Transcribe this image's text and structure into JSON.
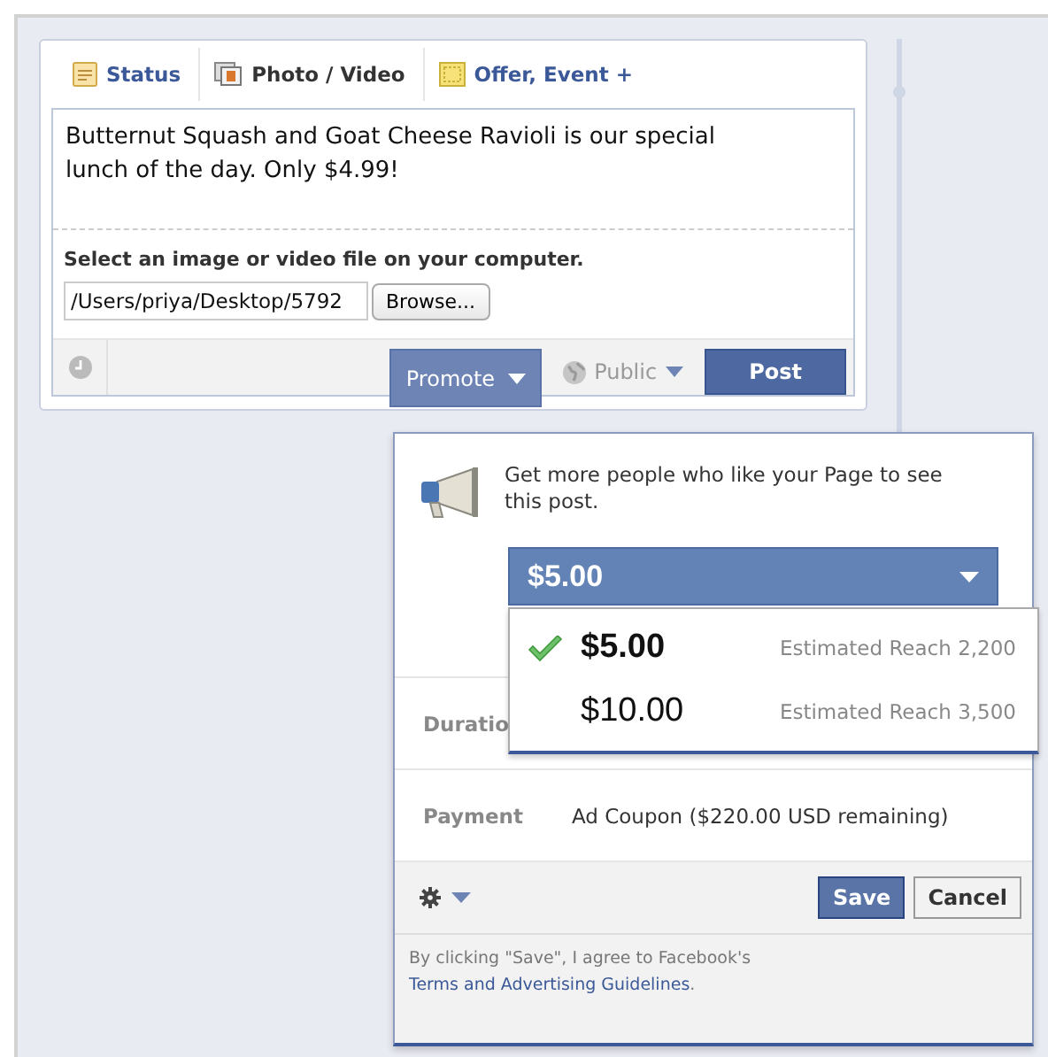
{
  "tabs": [
    {
      "label": "Status",
      "kind": "status",
      "selected": false
    },
    {
      "label": "Photo / Video",
      "kind": "photo",
      "selected": true
    },
    {
      "label": "Offer, Event +",
      "kind": "offer",
      "selected": false
    }
  ],
  "composer": {
    "text": "Butternut Squash and Goat Cheese Ravioli is our special lunch of the day. Only $4.99!",
    "upload_prompt": "Select an image or video file on your computer.",
    "file_path": "/Users/priya/Desktop/5792",
    "browse_button": "Browse..."
  },
  "actions": {
    "promote": "Promote",
    "promote_expanded": true,
    "privacy": "Public",
    "post": "Post"
  },
  "promote_popup": {
    "message": "Get more people who like your Page to see this post.",
    "budget": {
      "value": "$5.00",
      "expanded": true,
      "options": [
        {
          "amount": "$5.00",
          "reach": "Estimated Reach 2,200",
          "selected": true
        },
        {
          "amount": "$10.00",
          "reach": "Estimated Reach 3,500",
          "selected": false
        }
      ]
    },
    "details": [
      {
        "label": "Duratio"
      },
      {
        "label": "Payment",
        "value": "Ad Coupon ($220.00 USD remaining)"
      }
    ],
    "save": "Save",
    "cancel": "Cancel",
    "legal": "By clicking \"Save\", I agree to Facebook's",
    "legal_link": "Terms and Advertising Guidelines",
    "legal_end": "."
  }
}
